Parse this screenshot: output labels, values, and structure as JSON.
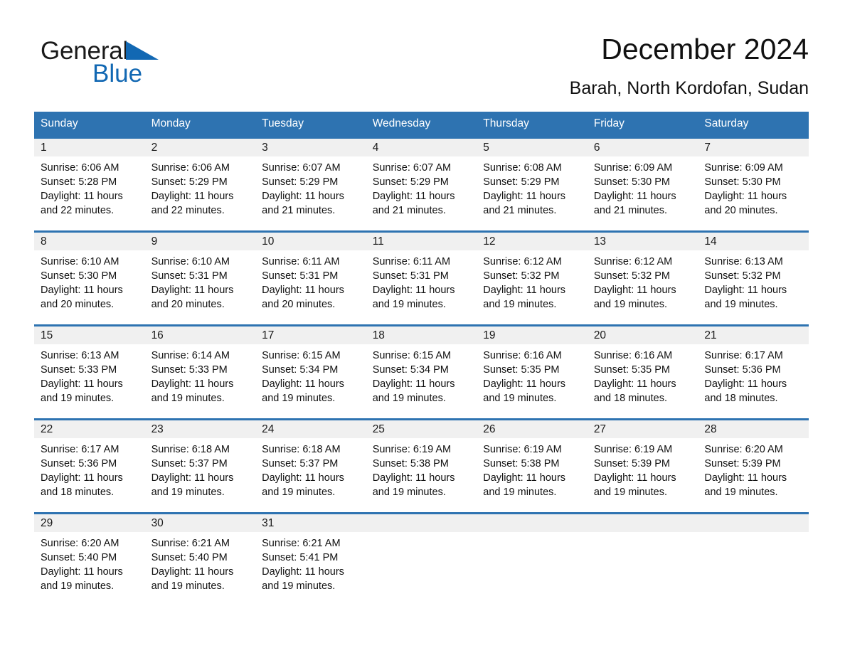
{
  "brand": {
    "name_part1": "General",
    "name_part2": "Blue",
    "logo_icon": "blue-triangle-logo",
    "accent_color": "#1268b3"
  },
  "header": {
    "title": "December 2024",
    "subtitle": "Barah, North Kordofan, Sudan"
  },
  "calendar": {
    "header_color": "#2E73B1",
    "daynum_band_color": "#F0F0F0",
    "weekdays": [
      "Sunday",
      "Monday",
      "Tuesday",
      "Wednesday",
      "Thursday",
      "Friday",
      "Saturday"
    ],
    "weeks": [
      [
        {
          "day": "1",
          "sunrise": "Sunrise: 6:06 AM",
          "sunset": "Sunset: 5:28 PM",
          "daylight_line1": "Daylight: 11 hours",
          "daylight_line2": "and 22 minutes."
        },
        {
          "day": "2",
          "sunrise": "Sunrise: 6:06 AM",
          "sunset": "Sunset: 5:29 PM",
          "daylight_line1": "Daylight: 11 hours",
          "daylight_line2": "and 22 minutes."
        },
        {
          "day": "3",
          "sunrise": "Sunrise: 6:07 AM",
          "sunset": "Sunset: 5:29 PM",
          "daylight_line1": "Daylight: 11 hours",
          "daylight_line2": "and 21 minutes."
        },
        {
          "day": "4",
          "sunrise": "Sunrise: 6:07 AM",
          "sunset": "Sunset: 5:29 PM",
          "daylight_line1": "Daylight: 11 hours",
          "daylight_line2": "and 21 minutes."
        },
        {
          "day": "5",
          "sunrise": "Sunrise: 6:08 AM",
          "sunset": "Sunset: 5:29 PM",
          "daylight_line1": "Daylight: 11 hours",
          "daylight_line2": "and 21 minutes."
        },
        {
          "day": "6",
          "sunrise": "Sunrise: 6:09 AM",
          "sunset": "Sunset: 5:30 PM",
          "daylight_line1": "Daylight: 11 hours",
          "daylight_line2": "and 21 minutes."
        },
        {
          "day": "7",
          "sunrise": "Sunrise: 6:09 AM",
          "sunset": "Sunset: 5:30 PM",
          "daylight_line1": "Daylight: 11 hours",
          "daylight_line2": "and 20 minutes."
        }
      ],
      [
        {
          "day": "8",
          "sunrise": "Sunrise: 6:10 AM",
          "sunset": "Sunset: 5:30 PM",
          "daylight_line1": "Daylight: 11 hours",
          "daylight_line2": "and 20 minutes."
        },
        {
          "day": "9",
          "sunrise": "Sunrise: 6:10 AM",
          "sunset": "Sunset: 5:31 PM",
          "daylight_line1": "Daylight: 11 hours",
          "daylight_line2": "and 20 minutes."
        },
        {
          "day": "10",
          "sunrise": "Sunrise: 6:11 AM",
          "sunset": "Sunset: 5:31 PM",
          "daylight_line1": "Daylight: 11 hours",
          "daylight_line2": "and 20 minutes."
        },
        {
          "day": "11",
          "sunrise": "Sunrise: 6:11 AM",
          "sunset": "Sunset: 5:31 PM",
          "daylight_line1": "Daylight: 11 hours",
          "daylight_line2": "and 19 minutes."
        },
        {
          "day": "12",
          "sunrise": "Sunrise: 6:12 AM",
          "sunset": "Sunset: 5:32 PM",
          "daylight_line1": "Daylight: 11 hours",
          "daylight_line2": "and 19 minutes."
        },
        {
          "day": "13",
          "sunrise": "Sunrise: 6:12 AM",
          "sunset": "Sunset: 5:32 PM",
          "daylight_line1": "Daylight: 11 hours",
          "daylight_line2": "and 19 minutes."
        },
        {
          "day": "14",
          "sunrise": "Sunrise: 6:13 AM",
          "sunset": "Sunset: 5:32 PM",
          "daylight_line1": "Daylight: 11 hours",
          "daylight_line2": "and 19 minutes."
        }
      ],
      [
        {
          "day": "15",
          "sunrise": "Sunrise: 6:13 AM",
          "sunset": "Sunset: 5:33 PM",
          "daylight_line1": "Daylight: 11 hours",
          "daylight_line2": "and 19 minutes."
        },
        {
          "day": "16",
          "sunrise": "Sunrise: 6:14 AM",
          "sunset": "Sunset: 5:33 PM",
          "daylight_line1": "Daylight: 11 hours",
          "daylight_line2": "and 19 minutes."
        },
        {
          "day": "17",
          "sunrise": "Sunrise: 6:15 AM",
          "sunset": "Sunset: 5:34 PM",
          "daylight_line1": "Daylight: 11 hours",
          "daylight_line2": "and 19 minutes."
        },
        {
          "day": "18",
          "sunrise": "Sunrise: 6:15 AM",
          "sunset": "Sunset: 5:34 PM",
          "daylight_line1": "Daylight: 11 hours",
          "daylight_line2": "and 19 minutes."
        },
        {
          "day": "19",
          "sunrise": "Sunrise: 6:16 AM",
          "sunset": "Sunset: 5:35 PM",
          "daylight_line1": "Daylight: 11 hours",
          "daylight_line2": "and 19 minutes."
        },
        {
          "day": "20",
          "sunrise": "Sunrise: 6:16 AM",
          "sunset": "Sunset: 5:35 PM",
          "daylight_line1": "Daylight: 11 hours",
          "daylight_line2": "and 18 minutes."
        },
        {
          "day": "21",
          "sunrise": "Sunrise: 6:17 AM",
          "sunset": "Sunset: 5:36 PM",
          "daylight_line1": "Daylight: 11 hours",
          "daylight_line2": "and 18 minutes."
        }
      ],
      [
        {
          "day": "22",
          "sunrise": "Sunrise: 6:17 AM",
          "sunset": "Sunset: 5:36 PM",
          "daylight_line1": "Daylight: 11 hours",
          "daylight_line2": "and 18 minutes."
        },
        {
          "day": "23",
          "sunrise": "Sunrise: 6:18 AM",
          "sunset": "Sunset: 5:37 PM",
          "daylight_line1": "Daylight: 11 hours",
          "daylight_line2": "and 19 minutes."
        },
        {
          "day": "24",
          "sunrise": "Sunrise: 6:18 AM",
          "sunset": "Sunset: 5:37 PM",
          "daylight_line1": "Daylight: 11 hours",
          "daylight_line2": "and 19 minutes."
        },
        {
          "day": "25",
          "sunrise": "Sunrise: 6:19 AM",
          "sunset": "Sunset: 5:38 PM",
          "daylight_line1": "Daylight: 11 hours",
          "daylight_line2": "and 19 minutes."
        },
        {
          "day": "26",
          "sunrise": "Sunrise: 6:19 AM",
          "sunset": "Sunset: 5:38 PM",
          "daylight_line1": "Daylight: 11 hours",
          "daylight_line2": "and 19 minutes."
        },
        {
          "day": "27",
          "sunrise": "Sunrise: 6:19 AM",
          "sunset": "Sunset: 5:39 PM",
          "daylight_line1": "Daylight: 11 hours",
          "daylight_line2": "and 19 minutes."
        },
        {
          "day": "28",
          "sunrise": "Sunrise: 6:20 AM",
          "sunset": "Sunset: 5:39 PM",
          "daylight_line1": "Daylight: 11 hours",
          "daylight_line2": "and 19 minutes."
        }
      ],
      [
        {
          "day": "29",
          "sunrise": "Sunrise: 6:20 AM",
          "sunset": "Sunset: 5:40 PM",
          "daylight_line1": "Daylight: 11 hours",
          "daylight_line2": "and 19 minutes."
        },
        {
          "day": "30",
          "sunrise": "Sunrise: 6:21 AM",
          "sunset": "Sunset: 5:40 PM",
          "daylight_line1": "Daylight: 11 hours",
          "daylight_line2": "and 19 minutes."
        },
        {
          "day": "31",
          "sunrise": "Sunrise: 6:21 AM",
          "sunset": "Sunset: 5:41 PM",
          "daylight_line1": "Daylight: 11 hours",
          "daylight_line2": "and 19 minutes."
        },
        {
          "day": "",
          "sunrise": "",
          "sunset": "",
          "daylight_line1": "",
          "daylight_line2": ""
        },
        {
          "day": "",
          "sunrise": "",
          "sunset": "",
          "daylight_line1": "",
          "daylight_line2": ""
        },
        {
          "day": "",
          "sunrise": "",
          "sunset": "",
          "daylight_line1": "",
          "daylight_line2": ""
        },
        {
          "day": "",
          "sunrise": "",
          "sunset": "",
          "daylight_line1": "",
          "daylight_line2": ""
        }
      ]
    ]
  }
}
